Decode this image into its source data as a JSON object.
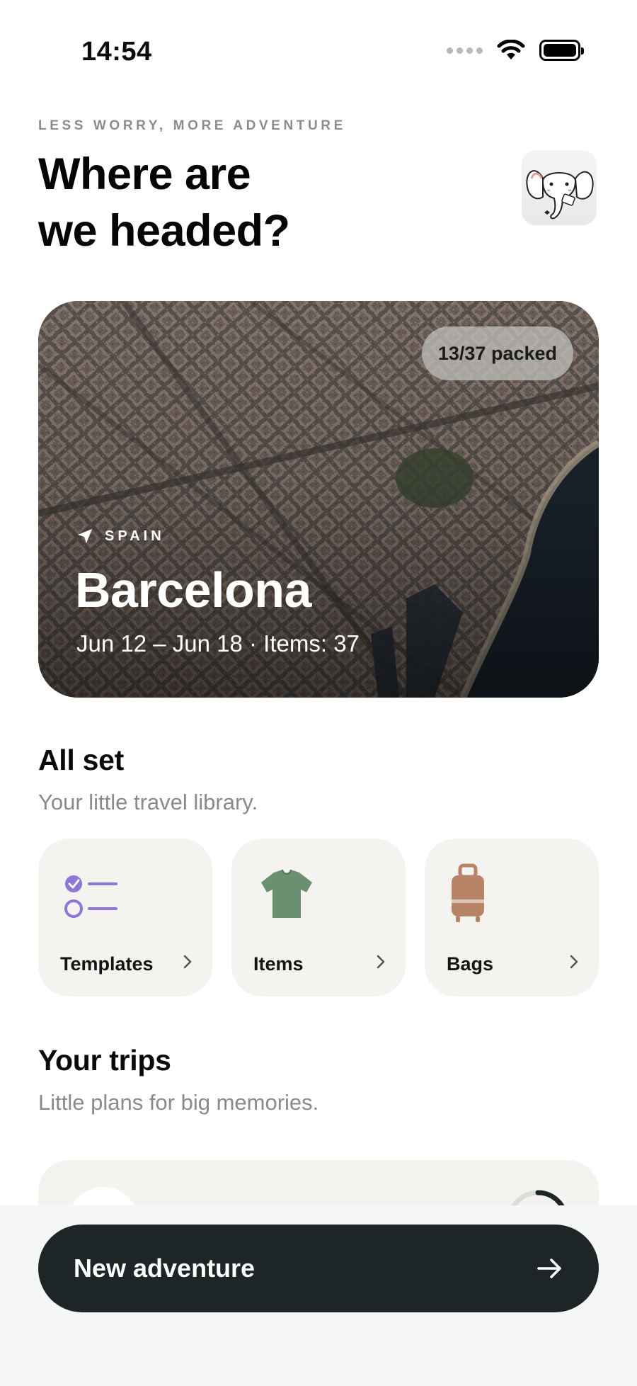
{
  "status_bar": {
    "time": "14:54"
  },
  "header": {
    "eyebrow": "LESS WORRY, MORE ADVENTURE",
    "title_line1": "Where are",
    "title_line2": "we headed?"
  },
  "hero_trip": {
    "packed_badge": "13/37 packed",
    "packed_count": 13,
    "total_items": 37,
    "country": "SPAIN",
    "city": "Barcelona",
    "meta": "Jun 12 – Jun 18 · Items: 37"
  },
  "library": {
    "title": "All set",
    "subtitle": "Your little travel library.",
    "tiles": [
      {
        "label": "Templates",
        "icon": "checklist-icon"
      },
      {
        "label": "Items",
        "icon": "tshirt-icon"
      },
      {
        "label": "Bags",
        "icon": "suitcase-icon"
      }
    ]
  },
  "trips": {
    "title": "Your trips",
    "subtitle": "Little plans for big memories."
  },
  "cta": {
    "label": "New adventure",
    "icon": "arrow-right-icon"
  },
  "colors": {
    "accent_purple": "#8b77d6",
    "tshirt_green": "#6b9070",
    "suitcase_brown": "#b88467",
    "cta_dark": "#1e2526",
    "tile_bg": "#f4f3ef"
  }
}
